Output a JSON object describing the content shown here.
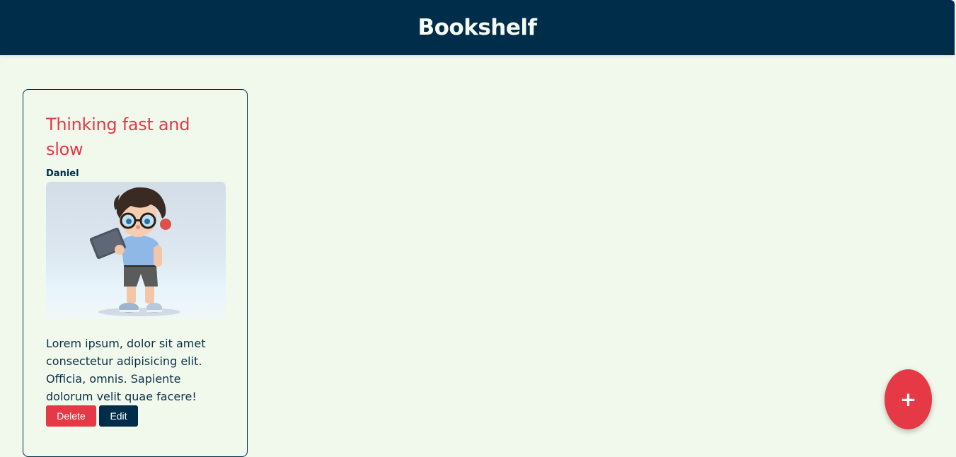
{
  "header": {
    "title": "Bookshelf"
  },
  "books": [
    {
      "title": "Thinking fast and slow",
      "author": "Daniel",
      "description": "Lorem ipsum, dolor sit amet consectetur adipisicing elit. Officia, omnis. Sapiente dolorum velit quae facere!",
      "delete_label": "Delete",
      "edit_label": "Edit"
    }
  ],
  "fab": {
    "label": "+",
    "icon": "plus-icon"
  },
  "colors": {
    "header_bg": "#002d4a",
    "page_bg": "#f0f9ec",
    "accent": "#e63946",
    "primary": "#002d4a"
  }
}
